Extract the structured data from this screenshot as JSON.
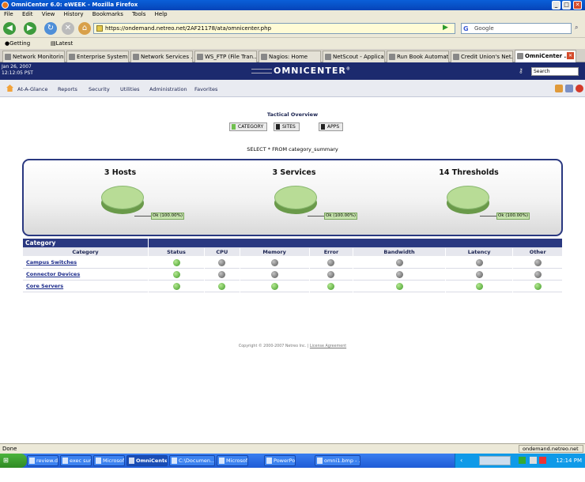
{
  "window": {
    "title": "OmniCenter 6.0: eWEEK - Mozilla Firefox",
    "min": "_",
    "max": "□",
    "close": "✕"
  },
  "menu": [
    "File",
    "Edit",
    "View",
    "History",
    "Bookmarks",
    "Tools",
    "Help"
  ],
  "nav": {
    "url": "https://ondemand.netreo.net/2AF21178/ata/omnicenter.php",
    "search_placeholder": "Google",
    "back_icon": "back-arrow-icon",
    "forward_icon": "forward-arrow-icon"
  },
  "bookmarks": [
    "Getting Started",
    "Latest Headlines"
  ],
  "tabs": [
    {
      "label": "Network Monitorin..."
    },
    {
      "label": "Enterprise System..."
    },
    {
      "label": "Network Services ..."
    },
    {
      "label": "WS_FTP (File Tran..."
    },
    {
      "label": "Nagios: Home"
    },
    {
      "label": "NetScout - Applica..."
    },
    {
      "label": "Run Book Automat..."
    },
    {
      "label": "Credit Union's Net..."
    },
    {
      "label": "OmniCenter ..."
    }
  ],
  "app": {
    "date": "Jan 26, 2007",
    "time": "12:12:05 PST",
    "logo": "OMNICENTER",
    "logo_reg": "®",
    "search_value": "Search",
    "nav_items": [
      "At-A-Glance",
      "Reports",
      "Security",
      "Utilities",
      "Administration",
      "Favorites"
    ]
  },
  "overview": {
    "title": "Tactical Overview",
    "buttons": [
      "CATEGORY",
      "SITES",
      "APPS"
    ],
    "query": "SELECT * FROM category_summary",
    "summaries": [
      {
        "title": "3 Hosts",
        "label": "Ok (100.00%)"
      },
      {
        "title": "3 Services",
        "label": "Ok (100.00%)"
      },
      {
        "title": "14 Thresholds",
        "label": "Ok (100.00%)"
      }
    ]
  },
  "chart_data": [
    {
      "type": "pie",
      "title": "3 Hosts",
      "categories": [
        "Ok"
      ],
      "values": [
        100.0
      ],
      "labels": [
        "Ok (100.00%)"
      ]
    },
    {
      "type": "pie",
      "title": "3 Services",
      "categories": [
        "Ok"
      ],
      "values": [
        100.0
      ],
      "labels": [
        "Ok (100.00%)"
      ]
    },
    {
      "type": "pie",
      "title": "14 Thresholds",
      "categories": [
        "Ok"
      ],
      "values": [
        100.0
      ],
      "labels": [
        "Ok (100.00%)"
      ]
    }
  ],
  "table": {
    "section_title": "Category",
    "columns": [
      "Category",
      "Status",
      "CPU",
      "Memory",
      "Error",
      "Bandwidth",
      "Latency",
      "Other"
    ],
    "rows": [
      {
        "name": "Campus Switches",
        "status": [
          "ok",
          "na",
          "na",
          "na",
          "na",
          "na",
          "na"
        ]
      },
      {
        "name": "Connector Devices",
        "status": [
          "ok",
          "na",
          "na",
          "na",
          "na",
          "na",
          "na"
        ]
      },
      {
        "name": "Core Servers",
        "status": [
          "ok",
          "ok",
          "ok",
          "ok",
          "ok",
          "ok",
          "ok"
        ]
      }
    ]
  },
  "footer": {
    "copyright": "Copyright © 2000-2007 Netreo Inc.",
    "separator": "|",
    "license": "License Agreement"
  },
  "status": {
    "text": "Done",
    "domain": "ondemand.netreo.net"
  },
  "taskbar": {
    "start": "Start",
    "items": [
      "review.doc -...",
      "exec sum.do...",
      "Microsoft Ou...",
      "OmniCente...",
      "C:\\Documen...",
      "Microsoft Po...",
      "PowerPoint ...",
      "omni1.bmp - ..."
    ],
    "clock": "12:14 PM"
  }
}
